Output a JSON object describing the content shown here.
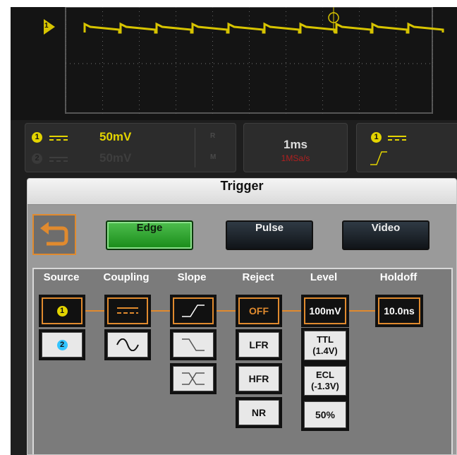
{
  "colors": {
    "ch1": "#e3d400",
    "ch2": "#33c4ff",
    "accent": "#e08a2e",
    "panel_bg": "#9a9a9a",
    "edge_green": "#1f9a1f"
  },
  "waveform": {
    "trigger_marker_label": "1",
    "trigger_icon": "trigger-level-icon"
  },
  "channels": [
    {
      "number": "1",
      "volts_div": "50mV",
      "coupling_icon": "dc-coupling-icon"
    },
    {
      "number": "2",
      "volts_div": "50mV",
      "coupling_icon": "dc-coupling-icon"
    }
  ],
  "indicators": {
    "r": "R",
    "m": "M"
  },
  "timebase": {
    "time_div": "1ms",
    "sample_rate": "1MSa/s"
  },
  "trigger_summary": {
    "source": "1",
    "slope_icon": "rising-edge-icon"
  },
  "trigger_panel": {
    "title": "Trigger",
    "back_icon": "back-arrow-icon",
    "modes": [
      {
        "label": "Edge",
        "selected": true
      },
      {
        "label": "Pulse",
        "selected": false
      },
      {
        "label": "Video",
        "selected": false
      }
    ],
    "columns": {
      "source": {
        "header": "Source",
        "options": [
          "1",
          "2"
        ],
        "selected": "1"
      },
      "coupling": {
        "header": "Coupling",
        "options": [
          "dc-coupling-icon",
          "ac-coupling-icon"
        ],
        "selected": "dc-coupling-icon"
      },
      "slope": {
        "header": "Slope",
        "options": [
          "rising-edge-icon",
          "falling-edge-icon",
          "either-edge-icon"
        ],
        "selected": "rising-edge-icon"
      },
      "reject": {
        "header": "Reject",
        "options": [
          "OFF",
          "LFR",
          "HFR",
          "NR"
        ],
        "selected": "OFF"
      },
      "level": {
        "header": "Level",
        "options": [
          "100mV",
          "TTL\n(1.4V)",
          "ECL\n(-1.3V)",
          "50%"
        ],
        "selected": "100mV"
      },
      "holdoff": {
        "header": "Holdoff",
        "options": [
          "10.0ns"
        ],
        "selected": "10.0ns"
      }
    }
  }
}
